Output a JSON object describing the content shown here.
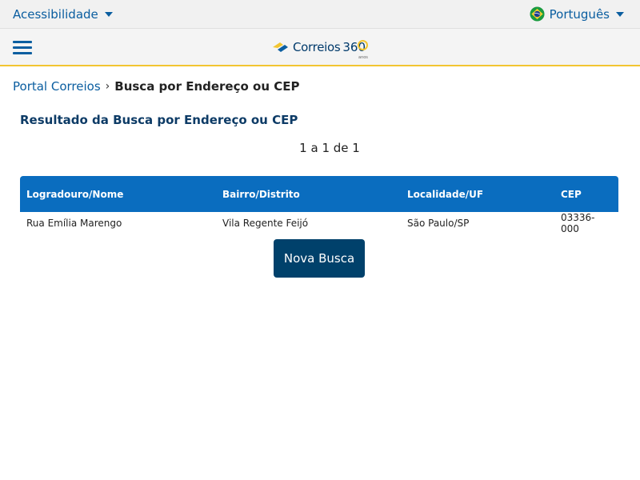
{
  "topbar": {
    "accessibility_label": "Acessibilidade",
    "language_label": "Português"
  },
  "header": {
    "logo_text": "Correios",
    "logo_number": "360",
    "logo_subtext": "anos"
  },
  "breadcrumb": {
    "link": "Portal Correios",
    "separator": "›",
    "current": "Busca por Endereço ou CEP"
  },
  "main": {
    "title": "Resultado da Busca por Endereço ou CEP",
    "pager": "1 a 1 de 1",
    "table": {
      "columns": [
        "Logradouro/Nome",
        "Bairro/Distrito",
        "Localidade/UF",
        "CEP"
      ],
      "rows": [
        [
          "Rua Emília Marengo",
          "Vila Regente Feijó",
          "São Paulo/SP",
          "03336-000"
        ]
      ]
    },
    "new_search_label": "Nova Busca"
  },
  "colors": {
    "link": "#0b5ea0",
    "table_header": "#0a6dbf",
    "button": "#00416b",
    "accent_border": "#f2c531"
  }
}
